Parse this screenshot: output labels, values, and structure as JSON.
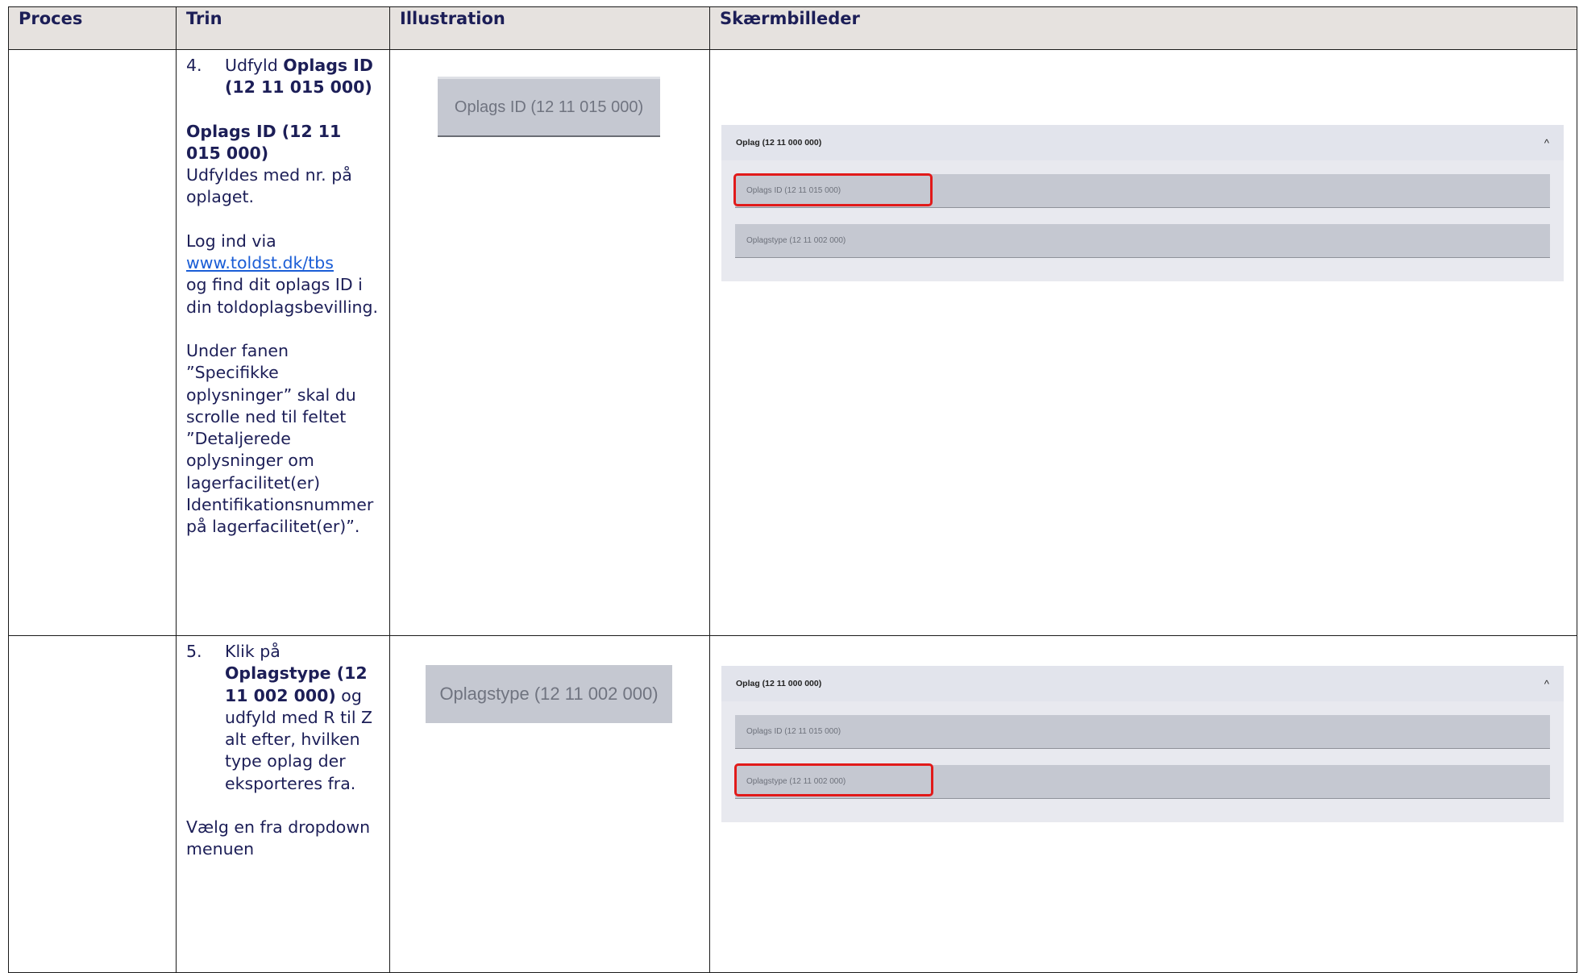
{
  "headers": {
    "proces": "Proces",
    "trin": "Trin",
    "illustration": "Illustration",
    "screenshots": "Skærmbilleder"
  },
  "row1": {
    "step_number": "4.",
    "step_prefix": "Udfyld ",
    "step_bold": "Oplags ID (12 11 015 000)",
    "field_heading": "Oplags ID (12 11 015 000)",
    "field_desc": "Udfyldes med nr. på oplaget.",
    "login_prefix": "Log ind via",
    "login_link": "www.toldst.dk/tbs",
    "login_suffix": "og find dit oplags ID i din toldoplagsbevilling.",
    "instruction": "Under fanen ”Specifikke oplysninger” skal du scrolle ned til feltet ”Detaljerede oplysninger om lagerfacilitet(er) Identifikationsnummer på lagerfacilitet(er)”.",
    "illustration_label": "Oplags ID (12 11 015 000)",
    "screen": {
      "panel_title": "Oplag (12 11 000 000)",
      "field1": "Oplags ID (12 11 015 000)",
      "field2": "Oplagstype (12 11 002 000)",
      "highlighted": "field1"
    }
  },
  "row2": {
    "step_number": "5.",
    "step_prefix": "Klik på ",
    "step_bold": "Oplagstype (12 11 002 000)",
    "step_suffix": " og udfyld med R til Z alt efter, hvilken type oplag der eksporteres fra.",
    "instruction": "Vælg en fra dropdown menuen",
    "illustration_label": "Oplagstype (12 11 002 000)",
    "screen": {
      "panel_title": "Oplag (12 11 000 000)",
      "field1": "Oplags ID (12 11 015 000)",
      "field2": "Oplagstype (12 11 002 000)",
      "highlighted": "field2"
    }
  },
  "icons": {
    "collapse": "chevron-up-icon"
  },
  "colors": {
    "header_bg": "#e6e2df",
    "text": "#1c1e57",
    "link": "#1a5dd6",
    "highlight": "#e11a1a",
    "field_bg": "#c5c8d1"
  }
}
